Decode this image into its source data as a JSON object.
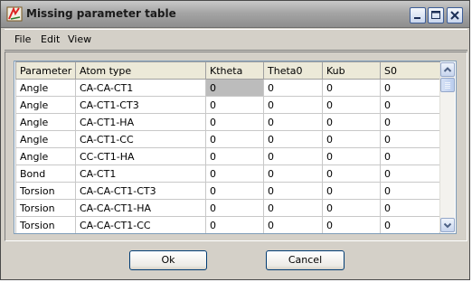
{
  "window": {
    "title": "Missing parameter table"
  },
  "menu": {
    "file": "File",
    "edit": "Edit",
    "view": "View"
  },
  "table": {
    "columns": [
      "Parameter",
      "Atom type",
      "Ktheta",
      "Theta0",
      "Kub",
      "S0"
    ],
    "rows": [
      [
        "Angle",
        "CA-CA-CT1",
        "0",
        "0",
        "0",
        "0"
      ],
      [
        "Angle",
        "CA-CT1-CT3",
        "0",
        "0",
        "0",
        "0"
      ],
      [
        "Angle",
        "CA-CT1-HA",
        "0",
        "0",
        "0",
        "0"
      ],
      [
        "Angle",
        "CA-CT1-CC",
        "0",
        "0",
        "0",
        "0"
      ],
      [
        "Angle",
        "CC-CT1-HA",
        "0",
        "0",
        "0",
        "0"
      ],
      [
        "Bond",
        "CA-CT1",
        "0",
        "0",
        "0",
        "0"
      ],
      [
        "Torsion",
        "CA-CA-CT1-CT3",
        "0",
        "0",
        "0",
        "0"
      ],
      [
        "Torsion",
        "CA-CA-CT1-HA",
        "0",
        "0",
        "0",
        "0"
      ],
      [
        "Torsion",
        "CA-CA-CT1-CC",
        "0",
        "0",
        "0",
        "0"
      ]
    ],
    "selected_row": 0,
    "selected_col": 2
  },
  "buttons": {
    "ok": "Ok",
    "cancel": "Cancel"
  },
  "colors": {
    "selection": "#bcbcbc",
    "button_border": "#003c74"
  }
}
